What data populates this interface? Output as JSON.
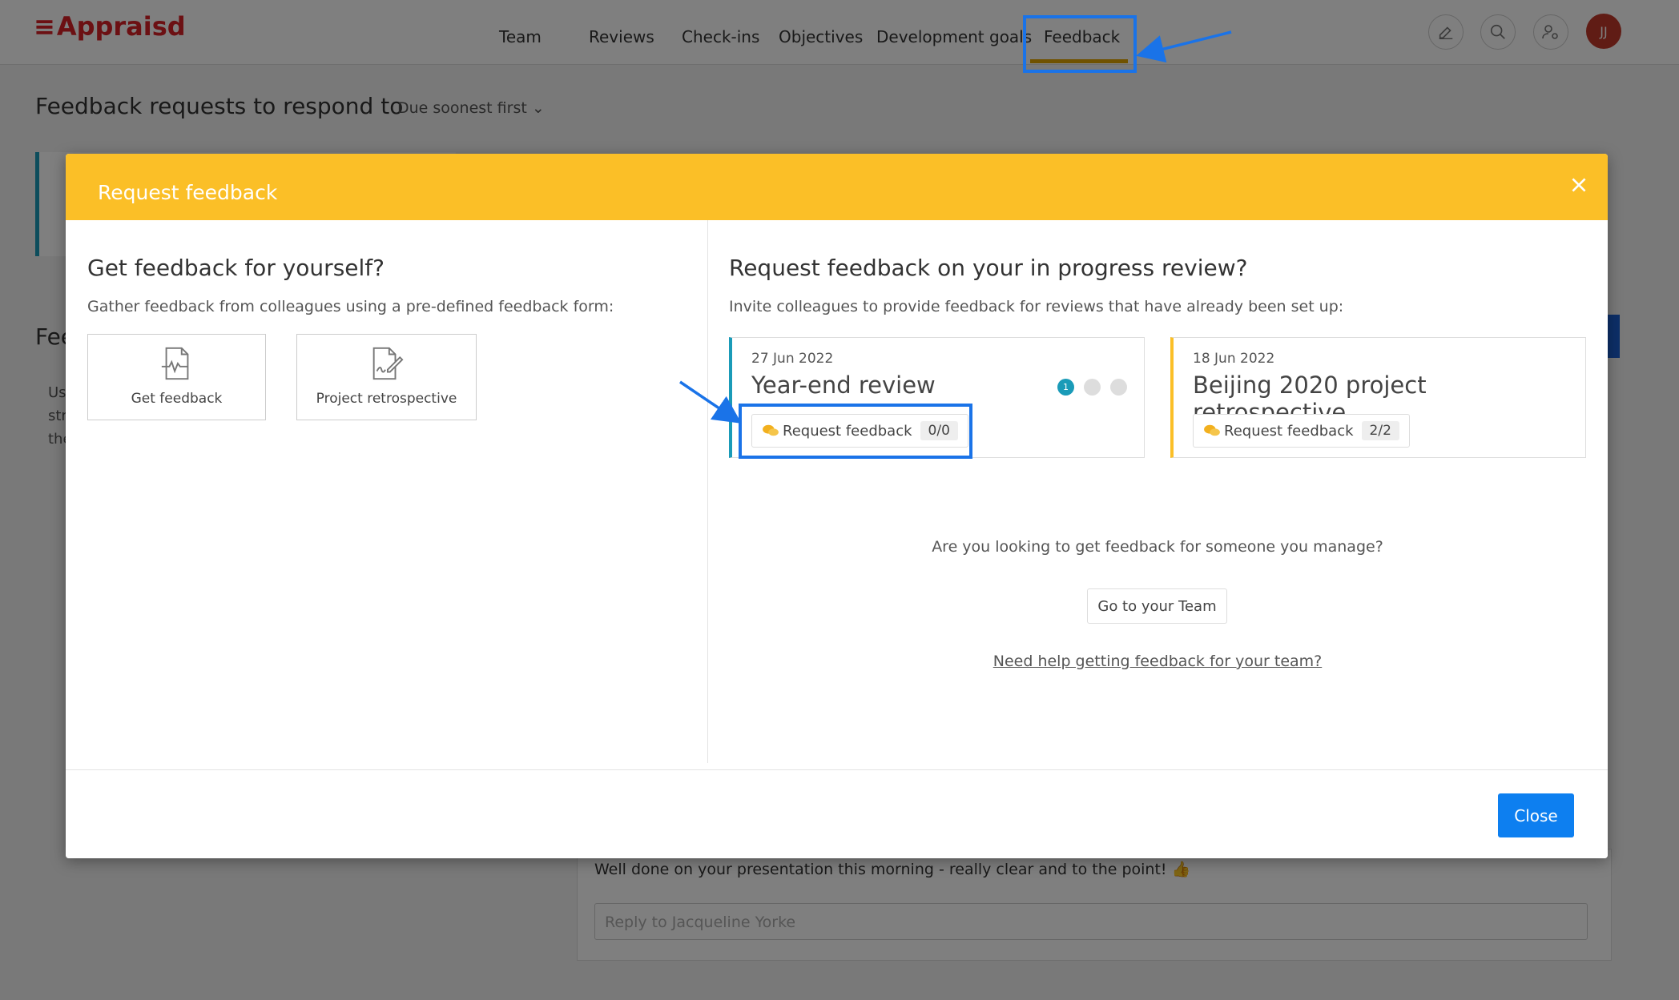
{
  "app": {
    "logo": "Appraisd"
  },
  "nav": {
    "items": [
      "Team",
      "Reviews",
      "Check-ins",
      "Objectives",
      "Development goals",
      "Feedback"
    ],
    "active": "Feedback"
  },
  "user": {
    "initials": "JJ"
  },
  "background": {
    "title": "Feedback requests to respond to",
    "sort_label": "Due soonest first",
    "heading2_partial": "Fee",
    "para_lines": [
      "Us",
      "str",
      "the"
    ],
    "message": "Well done on your presentation this morning - really clear and to the point! 👍",
    "reply_placeholder": "Reply to Jacqueline Yorke"
  },
  "modal": {
    "title": "Request feedback",
    "left": {
      "heading": "Get feedback for yourself?",
      "subtitle": "Gather feedback from colleagues using a pre-defined feedback form:",
      "forms": [
        {
          "label": "Get feedback",
          "icon": "document-pulse-icon"
        },
        {
          "label": "Project retrospective",
          "icon": "document-signature-icon"
        }
      ]
    },
    "right": {
      "heading": "Request feedback on your in progress review?",
      "subtitle": "Invite colleagues to provide feedback for reviews that have already been set up:",
      "reviews": [
        {
          "date": "27 Jun 2022",
          "title": "Year-end review",
          "button_label": "Request feedback",
          "count": "0/0",
          "accent": "#1a9bb8",
          "stage_current": "1"
        },
        {
          "date": "18 Jun 2022",
          "title": "Beijing 2020 project retrospective",
          "button_label": "Request feedback",
          "count": "2/2",
          "accent": "#fbbf27"
        }
      ],
      "manage_question": "Are you looking to get feedback for someone you manage?",
      "team_button": "Go to your Team",
      "help_link": "Need help getting feedback for your team?"
    },
    "close_label": "Close"
  },
  "colors": {
    "header": "#fbbf27",
    "primary": "#0d7ff0",
    "annotation": "#1a73e8",
    "brand": "#d92027"
  }
}
